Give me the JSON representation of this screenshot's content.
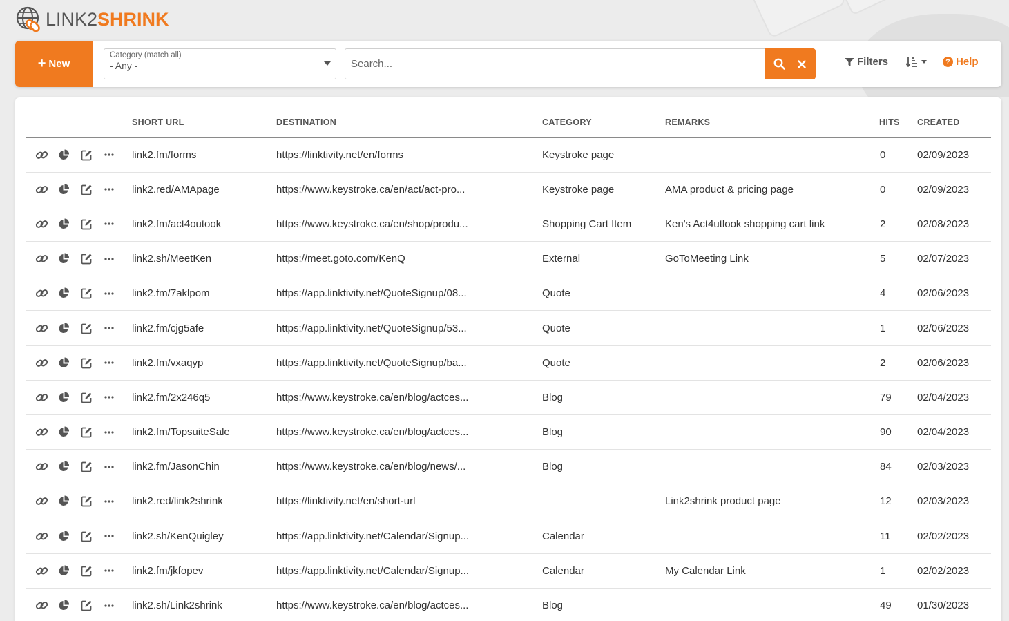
{
  "brand": {
    "part1": "LINK2",
    "part2": "SHRINK",
    "accent": "#f07a1f"
  },
  "toolbar": {
    "new_label": "New",
    "category_label": "Category (match all)",
    "category_value": "- Any -",
    "search_placeholder": "Search...",
    "filters_label": "Filters",
    "help_label": "Help"
  },
  "columns": [
    "SHORT URL",
    "DESTINATION",
    "CATEGORY",
    "REMARKS",
    "HITS",
    "CREATED"
  ],
  "rows": [
    {
      "short": "link2.fm/forms",
      "dest": "https://linktivity.net/en/forms",
      "cat": "Keystroke page",
      "rem": "",
      "hits": "0",
      "created": "02/09/2023"
    },
    {
      "short": "link2.red/AMApage",
      "dest": "https://www.keystroke.ca/en/act/act-pro...",
      "cat": "Keystroke page",
      "rem": "AMA product & pricing page",
      "hits": "0",
      "created": "02/09/2023"
    },
    {
      "short": "link2.fm/act4outook",
      "dest": "https://www.keystroke.ca/en/shop/produ...",
      "cat": "Shopping Cart Item",
      "rem": "Ken's Act4utlook shopping cart link",
      "hits": "2",
      "created": "02/08/2023"
    },
    {
      "short": "link2.sh/MeetKen",
      "dest": "https://meet.goto.com/KenQ",
      "cat": "External",
      "rem": "GoToMeeting Link",
      "hits": "5",
      "created": "02/07/2023"
    },
    {
      "short": "link2.fm/7aklpom",
      "dest": "https://app.linktivity.net/QuoteSignup/08...",
      "cat": "Quote",
      "rem": "",
      "hits": "4",
      "created": "02/06/2023"
    },
    {
      "short": "link2.fm/cjg5afe",
      "dest": "https://app.linktivity.net/QuoteSignup/53...",
      "cat": "Quote",
      "rem": "",
      "hits": "1",
      "created": "02/06/2023"
    },
    {
      "short": "link2.fm/vxaqyp",
      "dest": "https://app.linktivity.net/QuoteSignup/ba...",
      "cat": "Quote",
      "rem": "",
      "hits": "2",
      "created": "02/06/2023"
    },
    {
      "short": "link2.fm/2x246q5",
      "dest": "https://www.keystroke.ca/en/blog/actces...",
      "cat": "Blog",
      "rem": "",
      "hits": "79",
      "created": "02/04/2023"
    },
    {
      "short": "link2.fm/TopsuiteSale",
      "dest": "https://www.keystroke.ca/en/blog/actces...",
      "cat": "Blog",
      "rem": "",
      "hits": "90",
      "created": "02/04/2023"
    },
    {
      "short": "link2.fm/JasonChin",
      "dest": "https://www.keystroke.ca/en/blog/news/...",
      "cat": "Blog",
      "rem": "",
      "hits": "84",
      "created": "02/03/2023"
    },
    {
      "short": "link2.red/link2shrink",
      "dest": "https://linktivity.net/en/short-url",
      "cat": "",
      "rem": "Link2shrink product page",
      "hits": "12",
      "created": "02/03/2023"
    },
    {
      "short": "link2.sh/KenQuigley",
      "dest": "https://app.linktivity.net/Calendar/Signup...",
      "cat": "Calendar",
      "rem": "",
      "hits": "11",
      "created": "02/02/2023"
    },
    {
      "short": "link2.fm/jkfopev",
      "dest": "https://app.linktivity.net/Calendar/Signup...",
      "cat": "Calendar",
      "rem": "My Calendar Link",
      "hits": "1",
      "created": "02/02/2023"
    },
    {
      "short": "link2.sh/Link2shrink",
      "dest": "https://www.keystroke.ca/en/blog/actces...",
      "cat": "Blog",
      "rem": "",
      "hits": "49",
      "created": "01/30/2023"
    }
  ]
}
